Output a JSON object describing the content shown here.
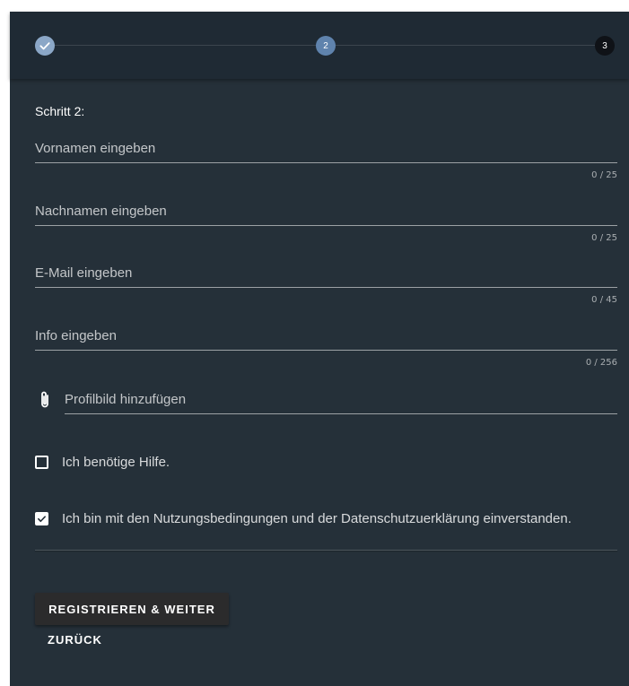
{
  "stepper": {
    "steps": [
      {
        "label": "",
        "state": "done",
        "icon": "check-icon"
      },
      {
        "label": "2",
        "state": "active"
      },
      {
        "label": "3",
        "state": "pending"
      }
    ]
  },
  "form": {
    "step_title": "Schritt 2:",
    "fields": [
      {
        "placeholder": "Vornamen eingeben",
        "value": "",
        "counter": "0 / 25"
      },
      {
        "placeholder": "Nachnamen eingeben",
        "value": "",
        "counter": "0 / 25"
      },
      {
        "placeholder": "E-Mail eingeben",
        "value": "",
        "counter": "0 / 45"
      },
      {
        "placeholder": "Info eingeben",
        "value": "",
        "counter": "0 / 256"
      }
    ],
    "attachment": {
      "label": "Profilbild hinzufügen",
      "icon": "paperclip-icon"
    },
    "checkboxes": [
      {
        "label": "Ich benötige Hilfe.",
        "checked": false
      },
      {
        "label": "Ich bin mit den Nutzungsbedingungen und der Datenschutzuerklärung einverstanden.",
        "checked": true
      }
    ]
  },
  "actions": {
    "primary_label": "REGISTRIEREN & WEITER",
    "back_label": "ZURÜCK"
  },
  "colors": {
    "card_background": "#253039",
    "stepper_background": "#1f2a34",
    "step_done": "#8ba7c7",
    "step_active": "#5f83ad",
    "step_pending": "#0f1217",
    "primary_button": "#2b2b2c"
  }
}
